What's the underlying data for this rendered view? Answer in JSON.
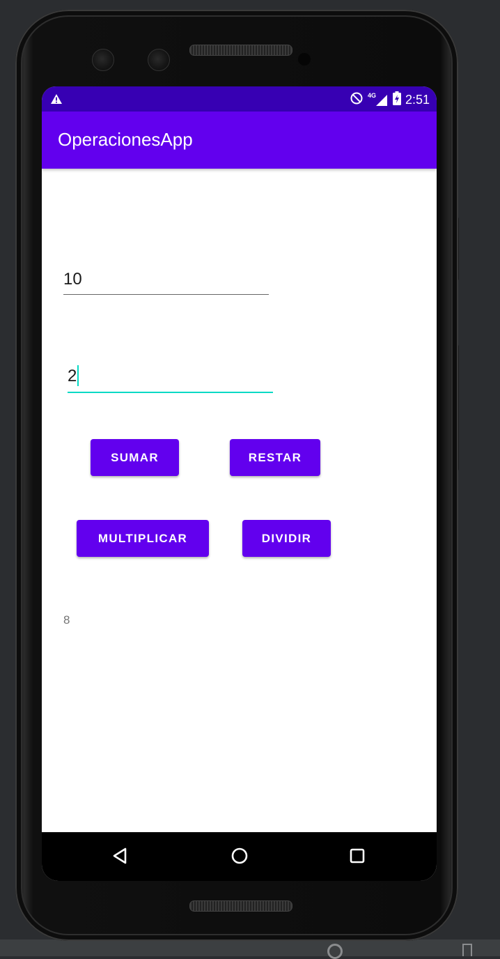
{
  "status_bar": {
    "time": "2:51",
    "network_label": "4G",
    "warning_icon": "warning-icon",
    "dnd_icon": "do-not-disturb-icon",
    "signal_icon": "signal-icon",
    "battery_icon": "battery-charging-icon"
  },
  "app_bar": {
    "title": "OperacionesApp"
  },
  "form": {
    "first_number": "10",
    "second_number": "2"
  },
  "buttons": {
    "sumar": "SUMAR",
    "restar": "RESTAR",
    "multiplicar": "MULTIPLICAR",
    "dividir": "DIVIDIR"
  },
  "result": {
    "value": "8"
  },
  "nav_bar": {
    "back_icon": "back-triangle-icon",
    "home_icon": "home-circle-icon",
    "recents_icon": "recents-square-icon"
  },
  "colors": {
    "status_bar": "#3700b3",
    "primary": "#6200ee",
    "accent": "#03dac5",
    "emulator_background": "#2b2d30"
  }
}
